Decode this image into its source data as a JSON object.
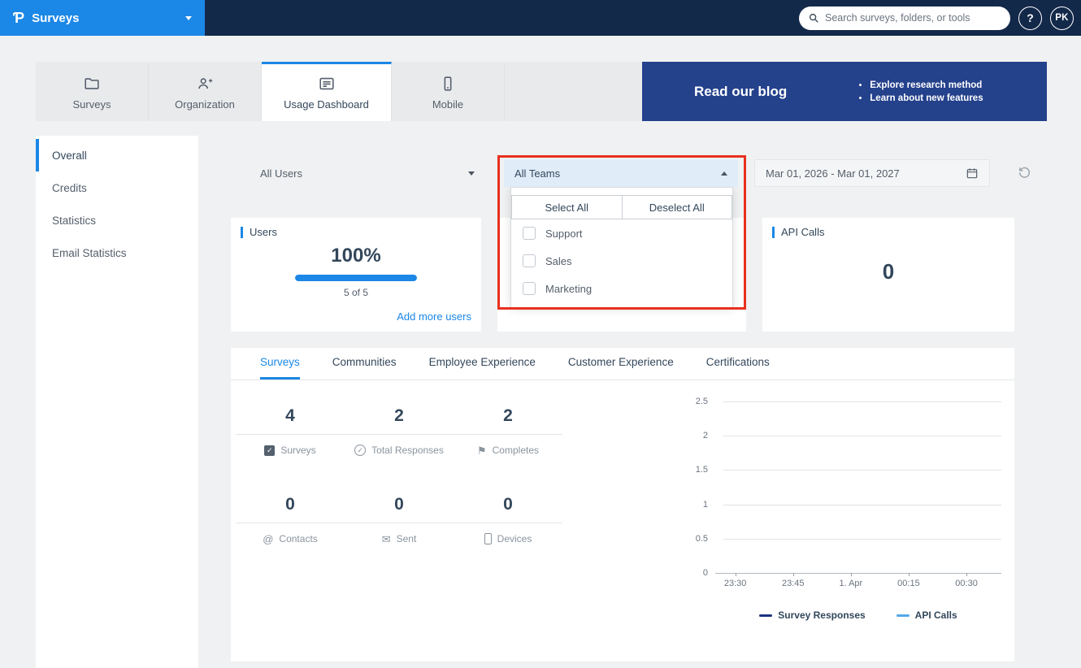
{
  "topbar": {
    "logo_glyph": "Ƥ",
    "app_name": "Surveys",
    "search_placeholder": "Search surveys, folders, or tools",
    "help_label": "?",
    "avatar_initials": "PK"
  },
  "main_tabs": [
    {
      "label": "Surveys",
      "active": false
    },
    {
      "label": "Organization",
      "active": false
    },
    {
      "label": "Usage Dashboard",
      "active": true
    },
    {
      "label": "Mobile",
      "active": false
    }
  ],
  "blog_banner": {
    "title": "Read our blog",
    "bullets": [
      "Explore research method",
      "Learn about new features"
    ]
  },
  "sidebar": {
    "items": [
      {
        "label": "Overall",
        "active": true
      },
      {
        "label": "Credits",
        "active": false
      },
      {
        "label": "Statistics",
        "active": false
      },
      {
        "label": "Email Statistics",
        "active": false
      }
    ]
  },
  "filters": {
    "users_value": "All Users",
    "teams_value": "All Teams",
    "date_range_value": "Mar 01, 2026 - Mar 01, 2027"
  },
  "teams_dropdown": {
    "select_all_label": "Select All",
    "deselect_all_label": "Deselect All",
    "options": [
      {
        "label": "Support",
        "checked": false
      },
      {
        "label": "Sales",
        "checked": false
      },
      {
        "label": "Marketing",
        "checked": false
      }
    ]
  },
  "cards": {
    "users": {
      "title": "Users",
      "percent": "100%",
      "progress_value": 100,
      "detail": "5 of 5",
      "link_label": "Add more users"
    },
    "api_calls": {
      "title": "API Calls",
      "value": "0"
    }
  },
  "stats_section": {
    "tabs": [
      {
        "label": "Surveys",
        "active": true
      },
      {
        "label": "Communities",
        "active": false
      },
      {
        "label": "Employee Experience",
        "active": false
      },
      {
        "label": "Customer Experience",
        "active": false
      },
      {
        "label": "Certifications",
        "active": false
      }
    ],
    "metrics": [
      {
        "value": "4",
        "label": "Surveys",
        "icon": "checkbox-icon",
        "glyph": "✓"
      },
      {
        "value": "2",
        "label": "Total Responses",
        "icon": "check-circle-icon",
        "glyph": "✓"
      },
      {
        "value": "2",
        "label": "Completes",
        "icon": "flag-icon",
        "glyph": "⚑"
      },
      {
        "value": "0",
        "label": "Contacts",
        "icon": "at-icon",
        "glyph": "@"
      },
      {
        "value": "0",
        "label": "Sent",
        "icon": "envelope-icon",
        "glyph": "✉"
      },
      {
        "value": "0",
        "label": "Devices",
        "icon": "mobile-icon",
        "glyph": ""
      }
    ]
  },
  "chart_data": {
    "type": "line",
    "y_ticks": [
      "2.5",
      "2",
      "1.5",
      "1",
      "0.5",
      "0"
    ],
    "x_ticks": [
      "23:30",
      "23:45",
      "1. Apr",
      "00:15",
      "00:30"
    ],
    "ylim": [
      0,
      2.5
    ],
    "grid": true,
    "legend_position": "bottom",
    "series": [
      {
        "name": "Survey Responses",
        "color": "#1b3380",
        "values": []
      },
      {
        "name": "API Calls",
        "color": "#54a8e8",
        "values": []
      }
    ]
  },
  "annotation_box": {
    "color": "#e8301e"
  },
  "colors": {
    "brand_blue": "#1b87e6",
    "topbar_navy": "#13294a",
    "banner_blue": "#24418c"
  }
}
